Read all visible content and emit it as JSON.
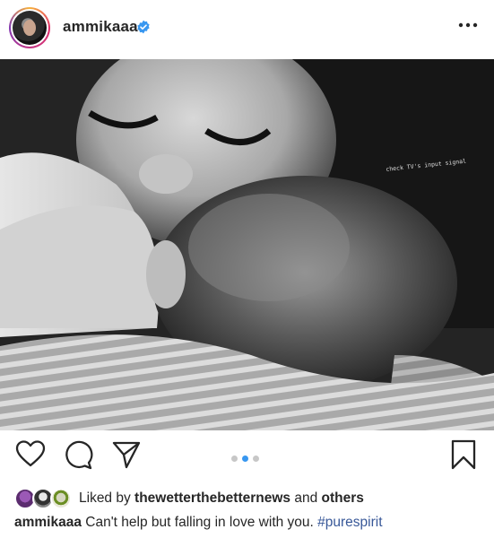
{
  "post": {
    "username": "ammikaaa",
    "verified": true,
    "more_icon": "more-horizontal-icon",
    "photo_overlay_text": "check TV's input signal"
  },
  "carousel": {
    "total": 3,
    "active_index": 1
  },
  "actions": {
    "like_icon": "heart-icon",
    "comment_icon": "comment-icon",
    "share_icon": "send-icon",
    "save_icon": "bookmark-icon"
  },
  "likes": {
    "prefix": "Liked by ",
    "user": "thewetterthebetternews",
    "joiner": " and ",
    "suffix": "others"
  },
  "caption": {
    "username": "ammikaaa",
    "text": " Can't help but falling in love with you. ",
    "hashtag": "#purespirit"
  },
  "colors": {
    "accent_blue": "#3897f0",
    "hashtag": "#385898",
    "text": "#262626"
  }
}
